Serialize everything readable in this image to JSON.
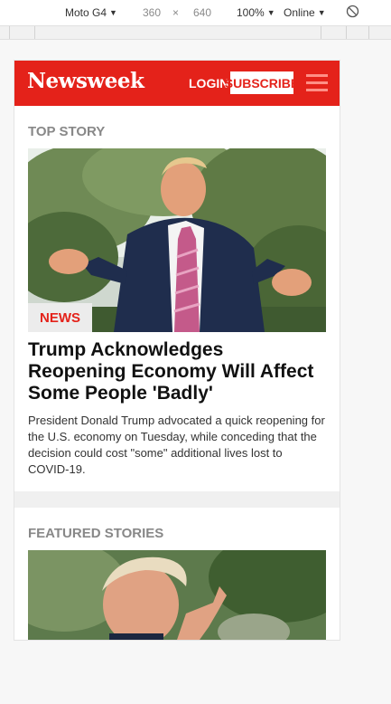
{
  "devtools": {
    "device": "Moto G4",
    "width": "360",
    "times": "×",
    "height": "640",
    "zoom": "100%",
    "network": "Online"
  },
  "header": {
    "logo": "Newsweek",
    "login": "LOGIN",
    "subscribe": "SUBSCRIBE"
  },
  "top_story": {
    "section_label": "TOP STORY",
    "badge": "NEWS",
    "headline": "Trump Acknowledges Reopening Economy Will Affect Some People 'Badly'",
    "summary": "President Donald Trump advocated a quick reopening for the U.S. economy on Tuesday, while conceding that the decision could cost \"some\" additional lives lost to COVID-19."
  },
  "featured": {
    "section_label": "FEATURED STORIES"
  },
  "colors": {
    "brand_red": "#e4221a",
    "label_gray": "#888888"
  }
}
